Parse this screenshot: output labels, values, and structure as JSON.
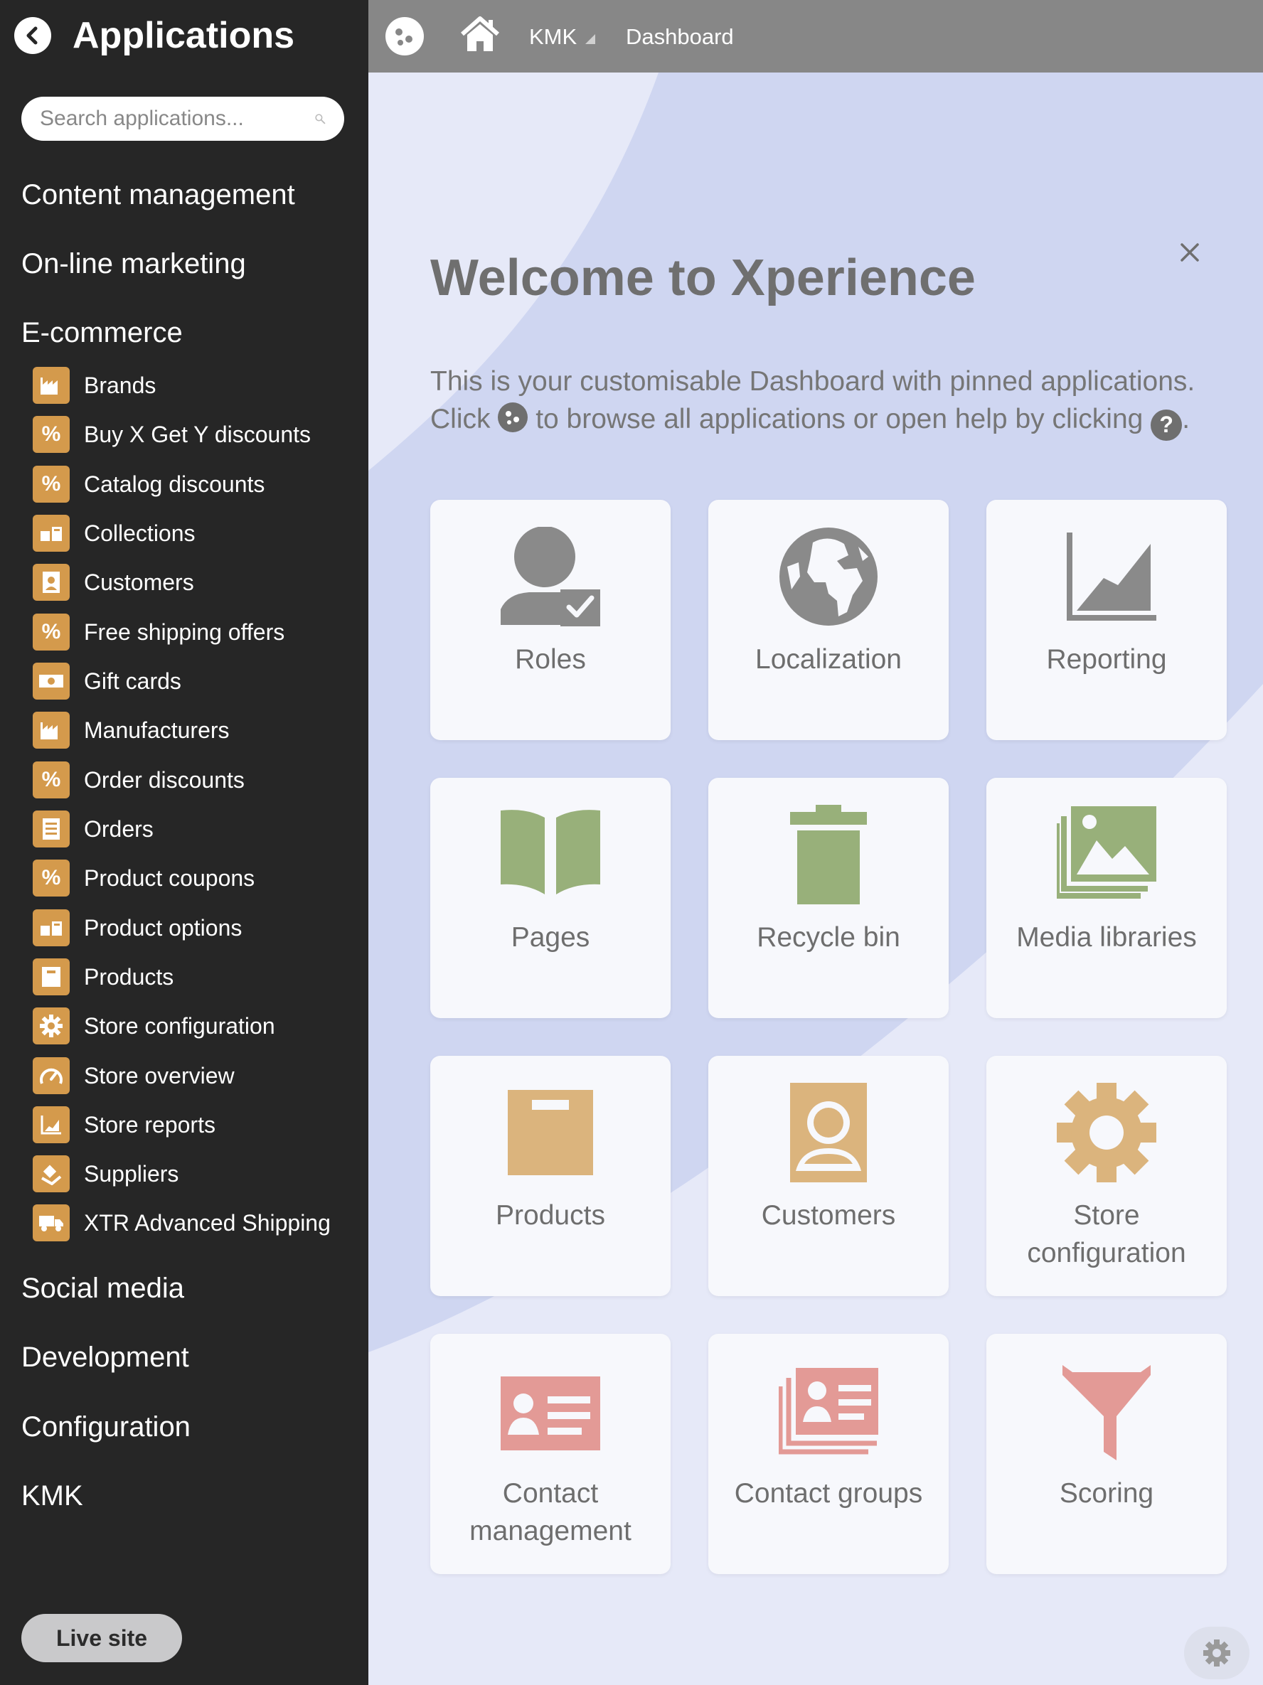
{
  "sidebar": {
    "title": "Applications",
    "search_placeholder": "Search applications...",
    "categories": {
      "content_management": "Content management",
      "online_marketing": "On-line marketing",
      "ecommerce": "E-commerce",
      "social_media": "Social media",
      "development": "Development",
      "configuration": "Configuration",
      "kmk": "KMK"
    },
    "ecommerce_items": [
      {
        "label": "Brands",
        "icon": "factory-icon"
      },
      {
        "label": "Buy X Get Y discounts",
        "icon": "percent-icon"
      },
      {
        "label": "Catalog discounts",
        "icon": "percent-icon"
      },
      {
        "label": "Collections",
        "icon": "boxes-icon"
      },
      {
        "label": "Customers",
        "icon": "customer-icon"
      },
      {
        "label": "Free shipping offers",
        "icon": "percent-icon"
      },
      {
        "label": "Gift cards",
        "icon": "money-icon"
      },
      {
        "label": "Manufacturers",
        "icon": "factory-icon"
      },
      {
        "label": "Order discounts",
        "icon": "percent-icon"
      },
      {
        "label": "Orders",
        "icon": "order-list-icon"
      },
      {
        "label": "Product coupons",
        "icon": "percent-icon"
      },
      {
        "label": "Product options",
        "icon": "boxes-icon"
      },
      {
        "label": "Products",
        "icon": "box-icon"
      },
      {
        "label": "Store configuration",
        "icon": "gear-icon"
      },
      {
        "label": "Store overview",
        "icon": "gauge-icon"
      },
      {
        "label": "Store reports",
        "icon": "chart-icon"
      },
      {
        "label": "Suppliers",
        "icon": "truck-loading-icon"
      },
      {
        "label": "XTR Advanced Shipping",
        "icon": "truck-icon"
      }
    ],
    "live_site": "Live site"
  },
  "topbar": {
    "site": "KMK",
    "current": "Dashboard"
  },
  "welcome": {
    "title": "Welcome to Xperience",
    "line1": "This is your customisable Dashboard with pinned applications.",
    "line2_a": "Click",
    "line2_b": "to browse all applications or open help by clicking",
    "help_glyph": "?",
    "period": "."
  },
  "tiles": [
    {
      "label": "Roles",
      "icon": "roles-icon",
      "color": "#8a8a8a"
    },
    {
      "label": "Localization",
      "icon": "globe-icon",
      "color": "#8a8a8a"
    },
    {
      "label": "Reporting",
      "icon": "area-chart-icon",
      "color": "#8a8a8a"
    },
    {
      "label": "Pages",
      "icon": "book-icon",
      "color": "#98b07a"
    },
    {
      "label": "Recycle bin",
      "icon": "trash-icon",
      "color": "#98b07a"
    },
    {
      "label": "Media libraries",
      "icon": "images-icon",
      "color": "#98b07a"
    },
    {
      "label": "Products",
      "icon": "box-icon",
      "color": "#dbb47d"
    },
    {
      "label": "Customers",
      "icon": "customer-icon",
      "color": "#dbb47d"
    },
    {
      "label": "Store configuration",
      "icon": "gear-icon",
      "color": "#dbb47d"
    },
    {
      "label": "Contact management",
      "icon": "contact-card-icon",
      "color": "#e39a96"
    },
    {
      "label": "Contact groups",
      "icon": "contact-cards-icon",
      "color": "#e39a96"
    },
    {
      "label": "Scoring",
      "icon": "funnel-icon",
      "color": "#e39a96"
    }
  ]
}
